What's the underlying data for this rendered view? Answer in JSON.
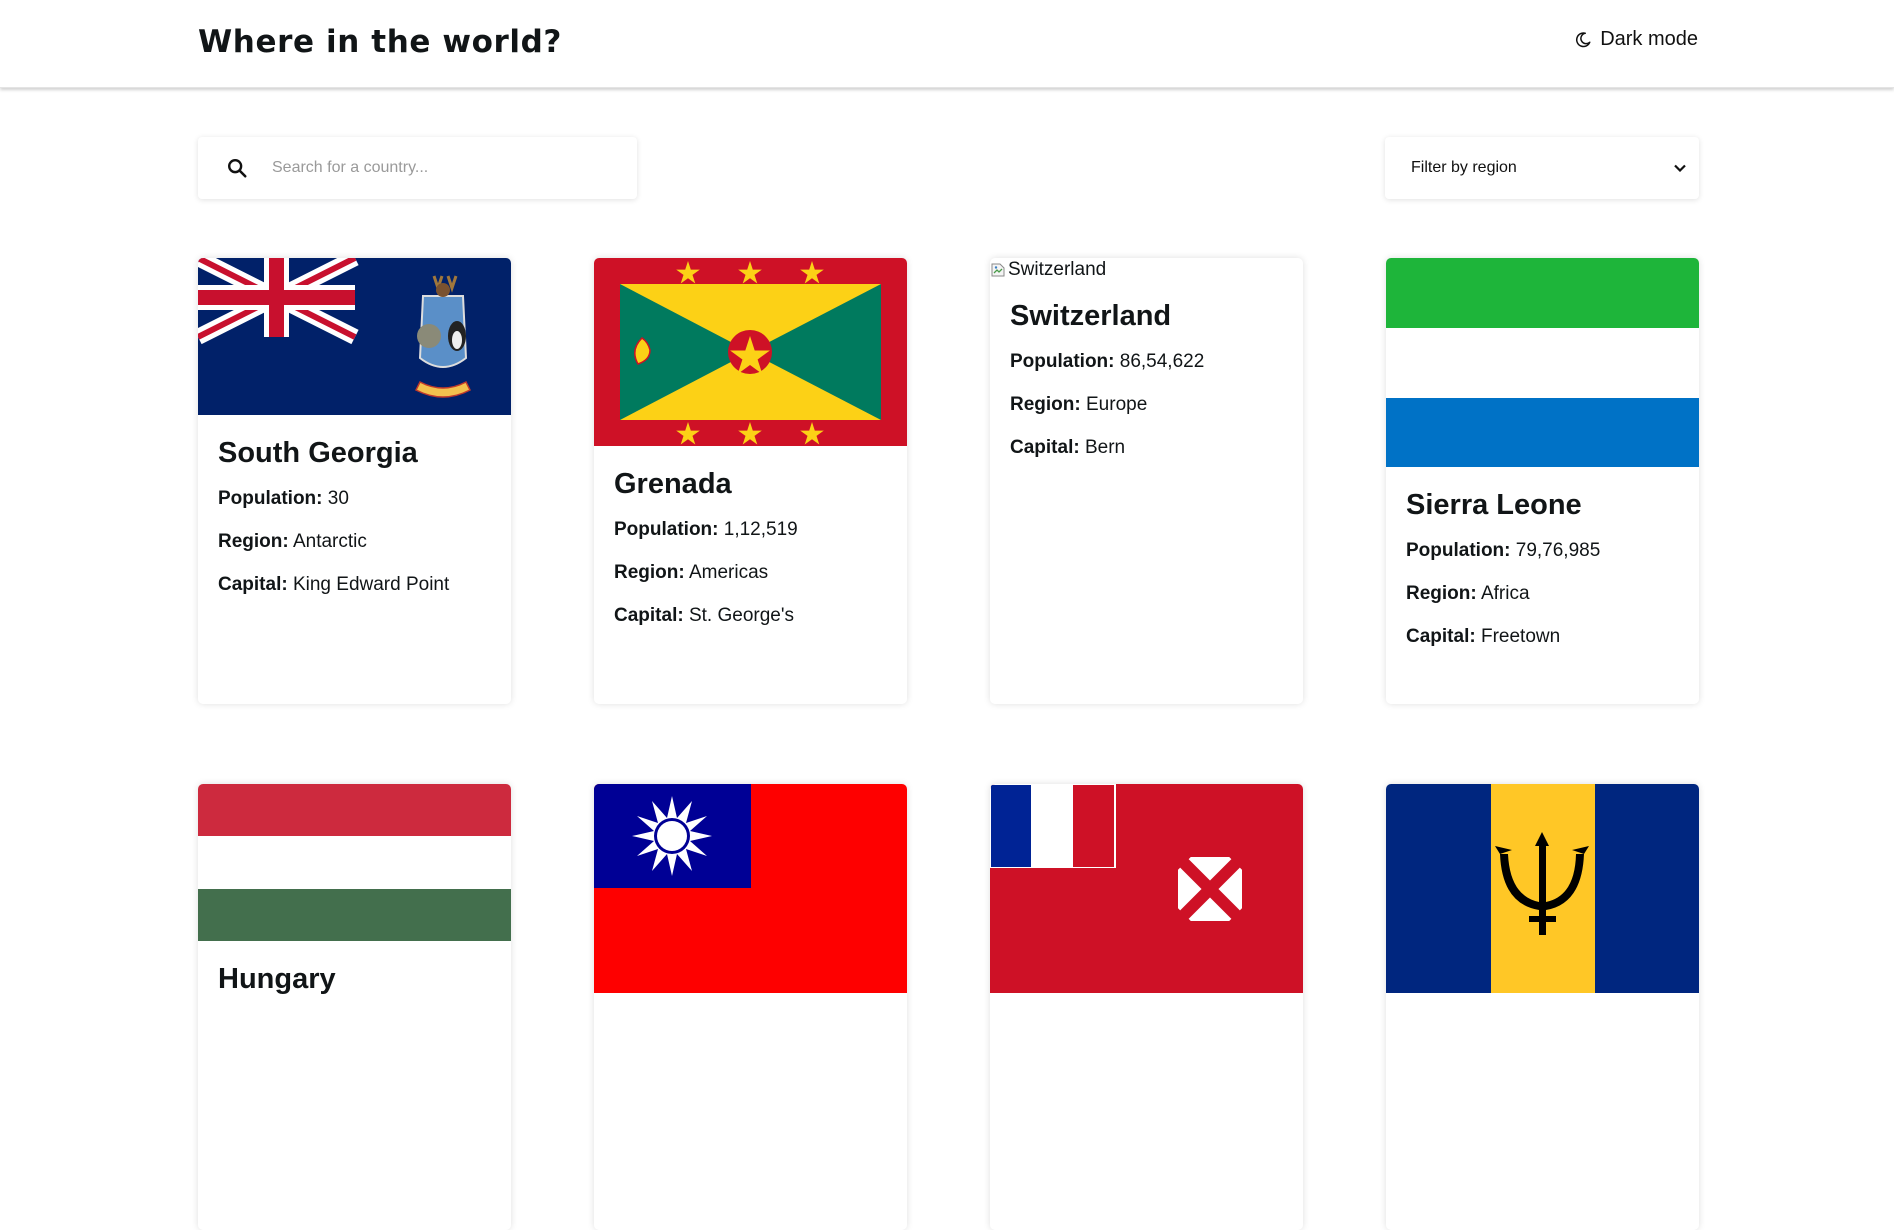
{
  "header": {
    "title": "Where in the world?",
    "dark_mode_label": "Dark mode",
    "dark_mode_icon": "moon-icon"
  },
  "search": {
    "placeholder": "Search for a country...",
    "icon": "search-icon"
  },
  "filter": {
    "label": "Filter by region",
    "icon": "chevron-down-icon"
  },
  "labels": {
    "population": "Population:",
    "region": "Region:",
    "capital": "Capital:"
  },
  "countries": [
    {
      "name": "South Georgia",
      "population": "30",
      "region": "Antarctic",
      "capital": "King Edward Point"
    },
    {
      "name": "Grenada",
      "population": "1,12,519",
      "region": "Americas",
      "capital": "St. George's"
    },
    {
      "name": "Switzerland",
      "population": "86,54,622",
      "region": "Europe",
      "capital": "Bern",
      "flag_alt": "Switzerland"
    },
    {
      "name": "Sierra Leone",
      "population": "79,76,985",
      "region": "Africa",
      "capital": "Freetown"
    },
    {
      "name": "Hungary"
    },
    {
      "name": ""
    },
    {
      "name": ""
    },
    {
      "name": ""
    }
  ],
  "colors": {
    "uk_blue": "#012169",
    "uk_red": "#C8102E",
    "grenada_red": "#CE1126",
    "grenada_yellow": "#FCD116",
    "grenada_green": "#007A5E",
    "sl_green": "#1EB53A",
    "sl_blue": "#0072C6",
    "hu_red": "#CD2A3E",
    "hu_green": "#436F4D",
    "tw_red": "#FE0000",
    "tw_blue": "#000095",
    "wf_red": "#CE1126",
    "bb_blue": "#00267F",
    "bb_gold": "#FFC726"
  }
}
